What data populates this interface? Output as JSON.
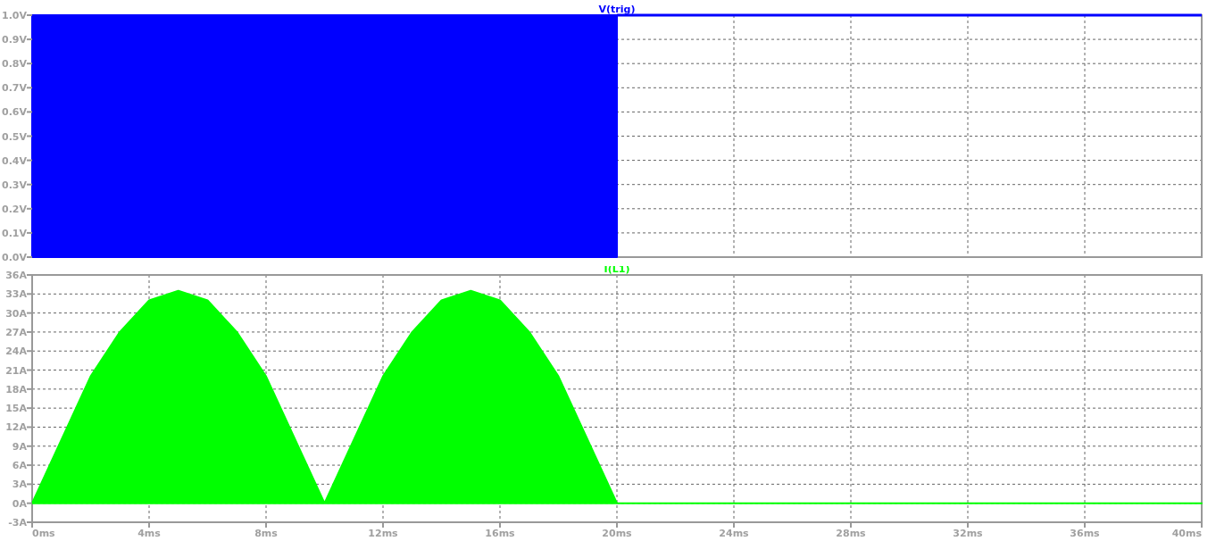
{
  "plots": [
    {
      "chart_data": {
        "type": "area",
        "title": "V(trig)",
        "grid": true,
        "x": [
          0,
          20,
          40
        ],
        "series": [
          {
            "color": "#0000ff",
            "values": [
              1,
              1,
              null
            ]
          },
          {
            "type": "line",
            "color": "#0000ff",
            "values": [
              null,
              1,
              1
            ]
          }
        ],
        "xlim": [
          0,
          40
        ],
        "ylim": [
          0,
          1
        ],
        "yticks": [
          {
            "value": 0,
            "label": "0.0V"
          },
          {
            "value": 0.1,
            "label": "0.1V"
          },
          {
            "value": 0.2,
            "label": "0.2V"
          },
          {
            "value": 0.3,
            "label": "0.3V"
          },
          {
            "value": 0.4,
            "label": "0.4V"
          },
          {
            "value": 0.5,
            "label": "0.5V"
          },
          {
            "value": 0.6,
            "label": "0.6V"
          },
          {
            "value": 0.7,
            "label": "0.7V"
          },
          {
            "value": 0.8,
            "label": "0.8V"
          },
          {
            "value": 0.9,
            "label": "0.9V"
          },
          {
            "value": 1,
            "label": "1.0V"
          }
        ]
      }
    },
    {
      "chart_data": {
        "type": "area",
        "title": "I(L1)",
        "grid": true,
        "x": [
          0,
          1,
          2,
          3,
          4,
          5,
          6,
          7,
          8,
          9,
          10,
          11,
          12,
          13,
          14,
          15,
          16,
          17,
          18,
          19,
          20,
          21,
          40
        ],
        "series": [
          {
            "color": "#00ff00",
            "values": [
              0,
              10,
              20,
              27,
              32,
              33.5,
              32,
              27,
              20,
              10,
              0,
              10,
              20,
              27,
              32,
              33.5,
              32,
              27,
              20,
              10,
              0,
              0,
              0
            ]
          }
        ],
        "xlim": [
          0,
          40
        ],
        "ylim": [
          -3,
          36
        ],
        "xticks": [
          {
            "value": 0,
            "label": "0ms"
          },
          {
            "value": 4,
            "label": "4ms"
          },
          {
            "value": 8,
            "label": "8ms"
          },
          {
            "value": 12,
            "label": "12ms"
          },
          {
            "value": 16,
            "label": "16ms"
          },
          {
            "value": 20,
            "label": "20ms"
          },
          {
            "value": 24,
            "label": "24ms"
          },
          {
            "value": 28,
            "label": "28ms"
          },
          {
            "value": 32,
            "label": "32ms"
          },
          {
            "value": 36,
            "label": "36ms"
          },
          {
            "value": 40,
            "label": "40ms"
          }
        ],
        "yticks": [
          {
            "value": -3,
            "label": "-3A"
          },
          {
            "value": 0,
            "label": "0A"
          },
          {
            "value": 3,
            "label": "3A"
          },
          {
            "value": 6,
            "label": "6A"
          },
          {
            "value": 9,
            "label": "9A"
          },
          {
            "value": 12,
            "label": "12A"
          },
          {
            "value": 15,
            "label": "15A"
          },
          {
            "value": 18,
            "label": "18A"
          },
          {
            "value": 21,
            "label": "21A"
          },
          {
            "value": 24,
            "label": "24A"
          },
          {
            "value": 27,
            "label": "27A"
          },
          {
            "value": 30,
            "label": "30A"
          },
          {
            "value": 33,
            "label": "33A"
          },
          {
            "value": 36,
            "label": "36A"
          }
        ]
      }
    }
  ]
}
